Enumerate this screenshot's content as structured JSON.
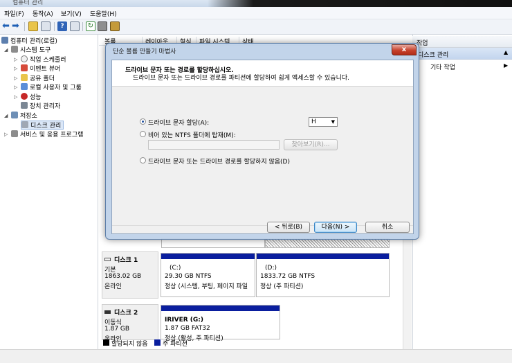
{
  "window": {
    "title": "컴퓨터 관리"
  },
  "menu": [
    "파일(F)",
    "동작(A)",
    "보기(V)",
    "도움말(H)"
  ],
  "tree": {
    "root": "컴퓨터 관리(로컬)",
    "system_tools": "시스템 도구",
    "task_scheduler": "작업 스케줄러",
    "event_viewer": "이벤트 뷰어",
    "shared_folders": "공유 폴더",
    "local_users": "로컬 사용자 및 그룹",
    "performance": "성능",
    "device_manager": "장치 관리자",
    "storage": "저장소",
    "disk_management": "디스크 관리",
    "services": "서비스 및 응용 프로그램"
  },
  "columns": [
    "볼륨",
    "레이아웃",
    "형식",
    "파일 시스템",
    "상태"
  ],
  "disks": [
    {
      "name": "디스크 1",
      "type": "기본",
      "size": "1863.02 GB",
      "status": "온라인",
      "partitions": [
        {
          "label": "(C:)",
          "size": "29.30 GB NTFS",
          "status": "정상 (시스템, 부팅, 페이지 파일"
        },
        {
          "label": "(D:)",
          "size": "1833.72 GB NTFS",
          "status": "정상 (주 파티션)"
        }
      ]
    },
    {
      "name": "디스크 2",
      "type": "이동식",
      "size": "1.87 GB",
      "status": "온라인",
      "partitions": [
        {
          "label": "IRIVER  (G:)",
          "size": "1.87 GB FAT32",
          "status": "정상 (활성, 주 파티션)"
        }
      ]
    }
  ],
  "legend": {
    "unallocated": "할당되지 않음",
    "primary": "주 파티션",
    "colors": {
      "unallocated": "#000000",
      "primary": "#0a1e9e"
    }
  },
  "actions": {
    "header": "작업",
    "selected": "디스크 관리",
    "more": "기타 작업"
  },
  "dialog": {
    "title": "단순 볼륨 만들기 마법사",
    "close": "x",
    "heading": "드라이브 문자 또는 경로를 할당하십시오.",
    "subheading": "드라이브 문자 또는 드라이브 경로를 파티션에 할당하여 쉽게 액세스할 수 있습니다.",
    "opt_assign": "드라이브 문자 할당(A):",
    "drive_letter": "H",
    "opt_mount": "비어 있는 NTFS 폴더에 탑재(M):",
    "browse": "찾아보기(R)...",
    "opt_none": "드라이브 문자 또는 드라이브 경로를 할당하지 않음(D)",
    "back": "< 뒤로(B)",
    "next": "다음(N) >",
    "cancel": "취소"
  }
}
